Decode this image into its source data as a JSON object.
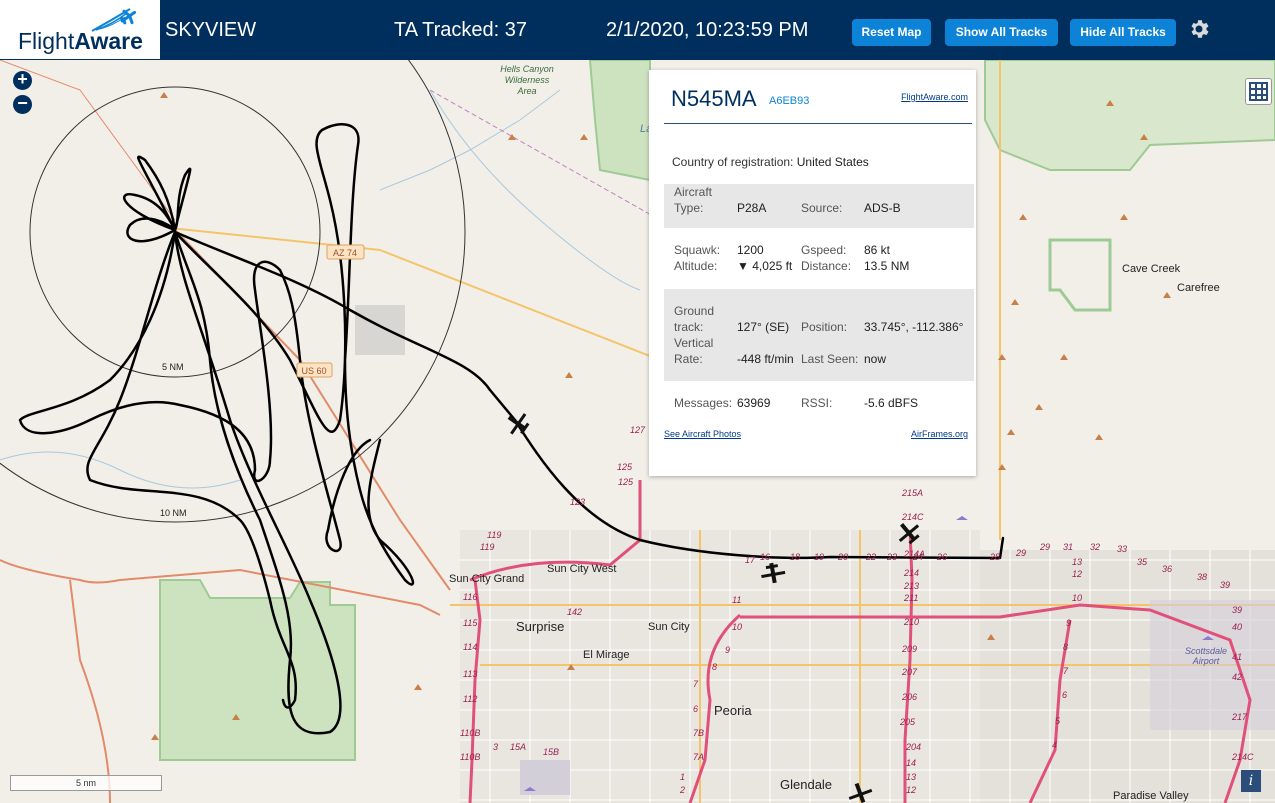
{
  "header": {
    "logo_text_a": "Flight",
    "logo_text_b": "Aware",
    "app_title": "SKYVIEW",
    "tracked_label": "TA Tracked: 37",
    "datetime": "2/1/2020, 10:23:59 PM",
    "buttons": {
      "reset": "Reset Map",
      "show": "Show All Tracks",
      "hide": "Hide All Tracks"
    },
    "settings_icon": "gear-icon"
  },
  "map": {
    "zoom_in": "+",
    "zoom_out": "−",
    "scale_label": "5 nm",
    "info": "i",
    "labels": {
      "hells_canyon": "Hells Canyon Wilderness Area",
      "lake": "La",
      "cave_creek": "Cave Creek",
      "carefree": "Carefree",
      "sun_city_grand": "Sun City Grand",
      "sun_city_west": "Sun City West",
      "surprise": "Surprise",
      "sun_city": "Sun City",
      "el_mirage": "El Mirage",
      "peoria": "Peoria",
      "glendale": "Glendale",
      "scottsdale": "Scottsdale Airport",
      "paradise_valley": "Paradise Valley"
    },
    "range_rings": {
      "ring5": "5 NM",
      "ring10": "10 NM"
    },
    "route_shields": {
      "az74": "AZ 74",
      "us60": "US 60"
    },
    "highway_numbers": [
      "123",
      "125",
      "125",
      "127",
      "119",
      "119",
      "116",
      "115",
      "114",
      "113",
      "112",
      "110B",
      "110B",
      "142",
      "17",
      "16",
      "18",
      "19",
      "20",
      "22",
      "23",
      "24",
      "26",
      "28",
      "29",
      "29",
      "31",
      "32",
      "33",
      "35",
      "36",
      "38",
      "39",
      "39",
      "40",
      "41",
      "42",
      "217",
      "214C",
      "215A",
      "214C",
      "214A",
      "214",
      "213",
      "211",
      "210",
      "209",
      "207",
      "206",
      "205",
      "204",
      "14",
      "13",
      "12",
      "11",
      "10",
      "9",
      "8",
      "7",
      "6",
      "7B",
      "7A",
      "1",
      "2",
      "3",
      "15A",
      "15B",
      "13",
      "12",
      "10",
      "9",
      "8",
      "7",
      "6",
      "5",
      "4"
    ]
  },
  "panel": {
    "registration": "N545MA",
    "icao": "A6EB93",
    "fa_link": "FlightAware.com",
    "country_label": "Country of registration:",
    "country_value": "United States",
    "aircraft_type_label_1": "Aircraft",
    "aircraft_type_label_2": "Type:",
    "aircraft_type_value": "P28A",
    "source_label": "Source:",
    "source_value": "ADS-B",
    "squawk_label": "Squawk:",
    "squawk_value": "1200",
    "gspeed_label": "Gspeed:",
    "gspeed_value": "86 kt",
    "altitude_label": "Altitude:",
    "altitude_value": "▼ 4,025 ft",
    "distance_label": "Distance:",
    "distance_value": "13.5 NM",
    "ground_track_label_1": "Ground",
    "ground_track_label_2": "track:",
    "ground_track_value": "127° (SE)",
    "position_label": "Position:",
    "position_value": "33.745°, -112.386°",
    "vrate_label_1": "Vertical",
    "vrate_label_2": "Rate:",
    "vrate_value": "-448 ft/min",
    "last_seen_label": "Last Seen:",
    "last_seen_value": "now",
    "messages_label": "Messages:",
    "messages_value": "63969",
    "rssi_label": "RSSI:",
    "rssi_value": "-5.6 dBFS",
    "photos_link": "See Aircraft Photos",
    "airframes_link": "AirFrames.org"
  }
}
